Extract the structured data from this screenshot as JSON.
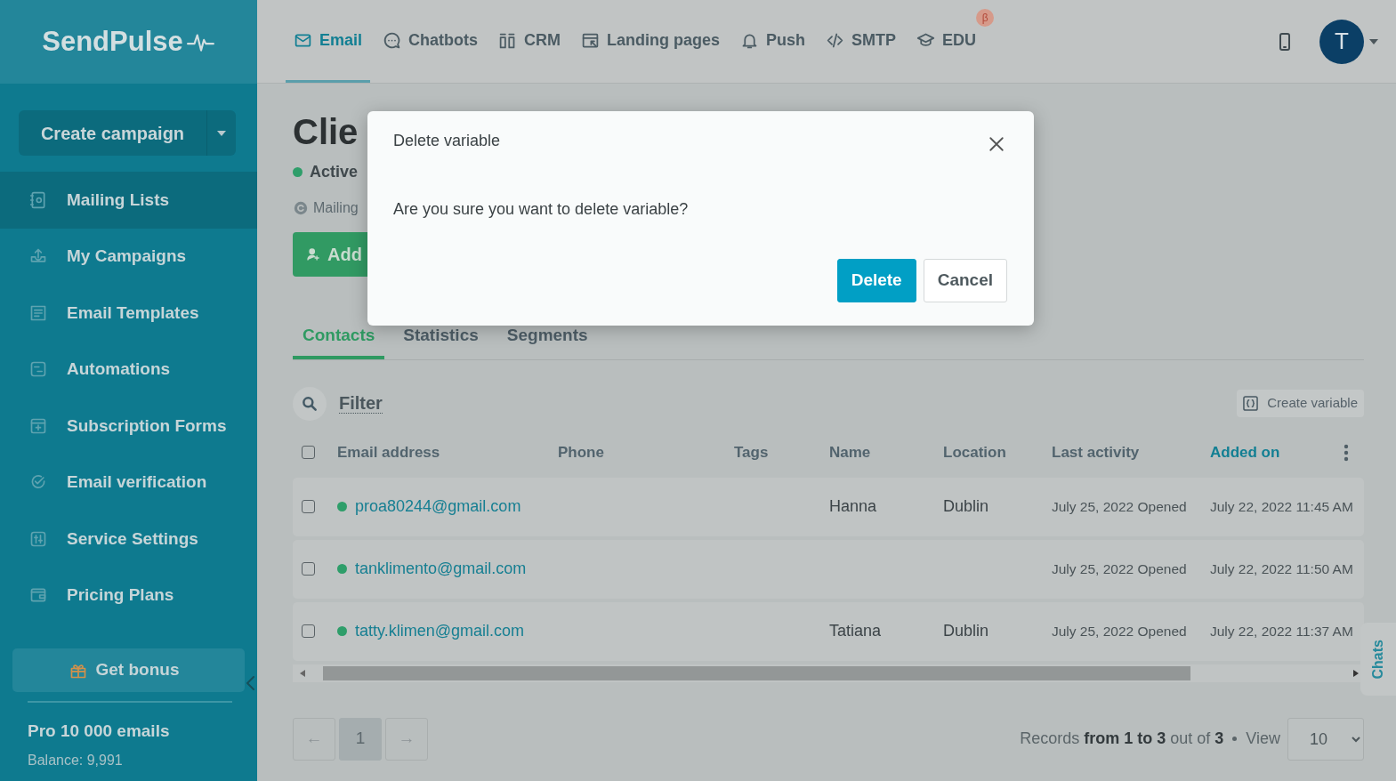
{
  "logo": {
    "text": "SendPulse"
  },
  "topnav": [
    {
      "label": "Email",
      "kind": "email",
      "selected": true
    },
    {
      "label": "Chatbots",
      "kind": "chat",
      "selected": false
    },
    {
      "label": "CRM",
      "kind": "crm",
      "selected": false
    },
    {
      "label": "Landing pages",
      "kind": "landing",
      "selected": false
    },
    {
      "label": "Push",
      "kind": "bell",
      "selected": false
    },
    {
      "label": "SMTP",
      "kind": "code",
      "selected": false
    },
    {
      "label": "EDU",
      "kind": "edu",
      "selected": false,
      "badge": "β"
    }
  ],
  "user": {
    "initial": "T"
  },
  "sidebar": {
    "create_button": "Create campaign",
    "items": [
      {
        "label": "Mailing Lists",
        "kind": "book",
        "selected": true
      },
      {
        "label": "My Campaigns",
        "kind": "upload",
        "selected": false
      },
      {
        "label": "Email Templates",
        "kind": "template",
        "selected": false
      },
      {
        "label": "Automations",
        "kind": "flow",
        "selected": false
      },
      {
        "label": "Subscription Forms",
        "kind": "form",
        "selected": false
      },
      {
        "label": "Email verification",
        "kind": "check",
        "selected": false
      },
      {
        "label": "Service Settings",
        "kind": "sliders",
        "selected": false
      },
      {
        "label": "Pricing Plans",
        "kind": "wallet",
        "selected": false
      }
    ],
    "bonus": "Get bonus",
    "plan": "Pro 10 000 emails",
    "balance": "Balance: 9,991"
  },
  "page": {
    "title": "Clie",
    "status": "Active",
    "breadcrumb": "Mailing",
    "add_button": "Add"
  },
  "tabs": [
    {
      "label": "Contacts",
      "selected": true
    },
    {
      "label": "Statistics",
      "selected": false
    },
    {
      "label": "Segments",
      "selected": false
    }
  ],
  "filter": "Filter",
  "create_variable": "Create variable",
  "select_all": {
    "checked": false
  },
  "table": {
    "columns": [
      {
        "label": "Email address",
        "selected": false
      },
      {
        "label": "Phone",
        "selected": false
      },
      {
        "label": "Tags",
        "selected": false
      },
      {
        "label": "Name",
        "selected": false
      },
      {
        "label": "Location",
        "selected": false
      },
      {
        "label": "Last activity",
        "selected": false
      },
      {
        "label": "Added on",
        "selected": true
      }
    ],
    "rows": [
      {
        "checked": false,
        "color": "#2e9e6a",
        "email": "proa80244@gmail.com",
        "name": "Hanna",
        "location": "Dublin",
        "last_activity": "July 25, 2022 Opened",
        "added_on": "July 22, 2022 11:45 AM"
      },
      {
        "checked": false,
        "color": "#2e9e6a",
        "email": "tanklimento@gmail.com",
        "last_activity": "July 25, 2022 Opened",
        "added_on": "July 22, 2022 11:50 AM"
      },
      {
        "checked": false,
        "color": "#2e9e6a",
        "email": "tatty.klimen@gmail.com",
        "name": "Tatiana",
        "location": "Dublin",
        "last_activity": "July 25, 2022 Opened",
        "added_on": "July 22, 2022 11:37 AM"
      }
    ]
  },
  "pagination": {
    "prev": "←",
    "pages": [
      {
        "label": "1",
        "selected": true
      }
    ],
    "next": "→"
  },
  "records": "Records **from 1 to 3** out of **3**",
  "view_label": "View",
  "view_value": "10",
  "chats": "Chats",
  "modal": {
    "title": "Delete variable",
    "message": "Are you sure you want to delete variable?",
    "buttons": [
      {
        "label": "Delete",
        "kind": "primary"
      },
      {
        "label": "Cancel",
        "kind": "secondary"
      }
    ]
  }
}
